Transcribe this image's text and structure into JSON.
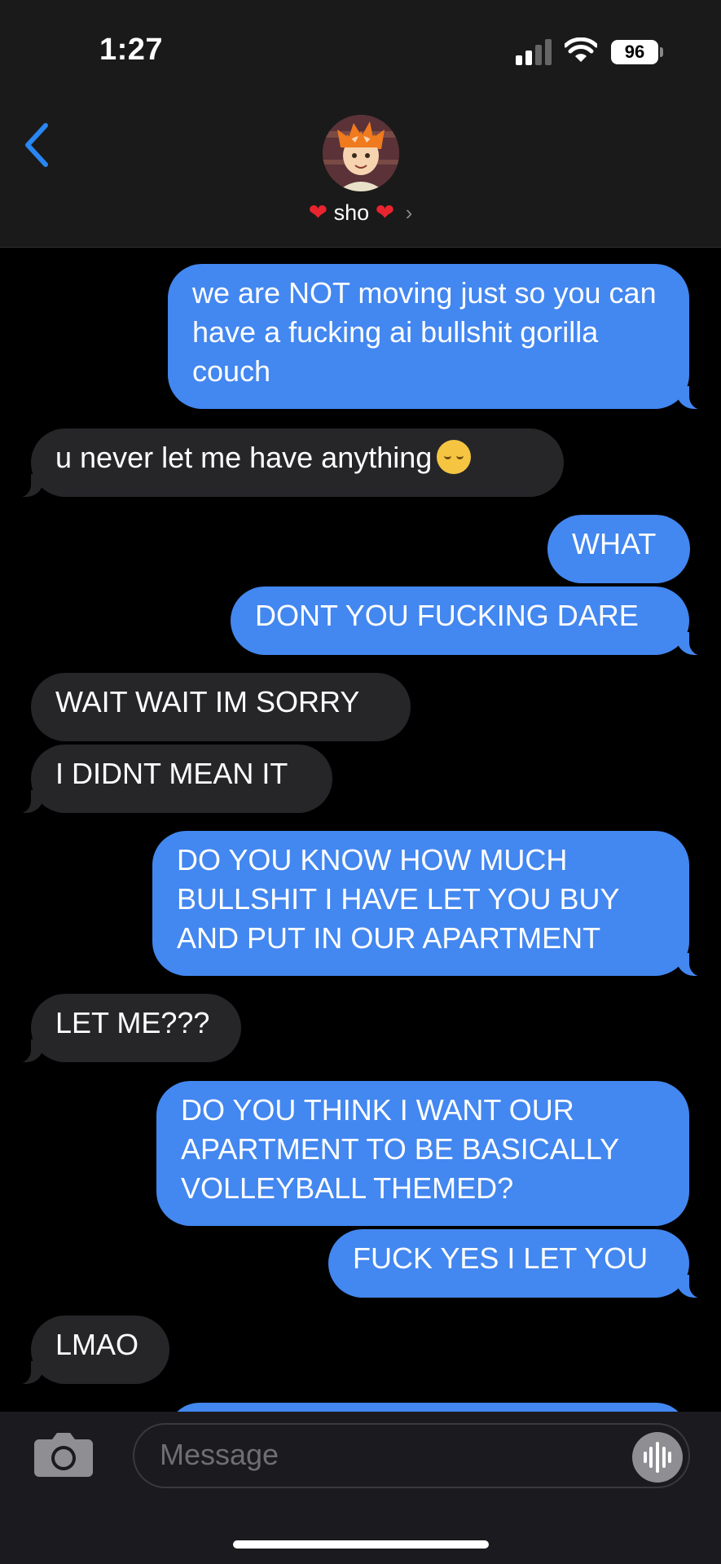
{
  "status_bar": {
    "time": "1:27",
    "battery": "96"
  },
  "header": {
    "contact_name": "sho",
    "heart_left": "❤",
    "heart_right": "❤",
    "chevron": "›"
  },
  "messages": [
    {
      "side": "out",
      "text": "we are NOT moving just so you can have a fucking ai bullshit gorilla couch"
    },
    {
      "side": "in",
      "text": "u never let me have anything"
    },
    {
      "side": "out",
      "text": "WHAT"
    },
    {
      "side": "out",
      "text": "DONT YOU FUCKING DARE"
    },
    {
      "side": "in",
      "text": "WAIT WAIT IM SORRY"
    },
    {
      "side": "in",
      "text": "I DIDNT MEAN IT"
    },
    {
      "side": "out",
      "text": "DO YOU KNOW HOW MUCH BULLSHIT I HAVE LET YOU BUY AND PUT IN OUR APARTMENT"
    },
    {
      "side": "in",
      "text": "LET ME???"
    },
    {
      "side": "out",
      "text": "DO YOU THINK I WANT OUR APARTMENT TO BE BASICALLY VOLLEYBALL THEMED?"
    },
    {
      "side": "out",
      "text": "FUCK YES I LET YOU"
    },
    {
      "side": "in",
      "text": "LMAO"
    }
  ],
  "composer": {
    "placeholder": "Message"
  },
  "icons": [
    "back-chevron-icon",
    "signal-icon",
    "wifi-icon",
    "battery-icon",
    "camera-icon",
    "audio-waveform-icon",
    "pensive-face-emoji"
  ],
  "colors": {
    "outgoing": "#4387f0",
    "incoming": "#262629",
    "background": "#000000"
  }
}
